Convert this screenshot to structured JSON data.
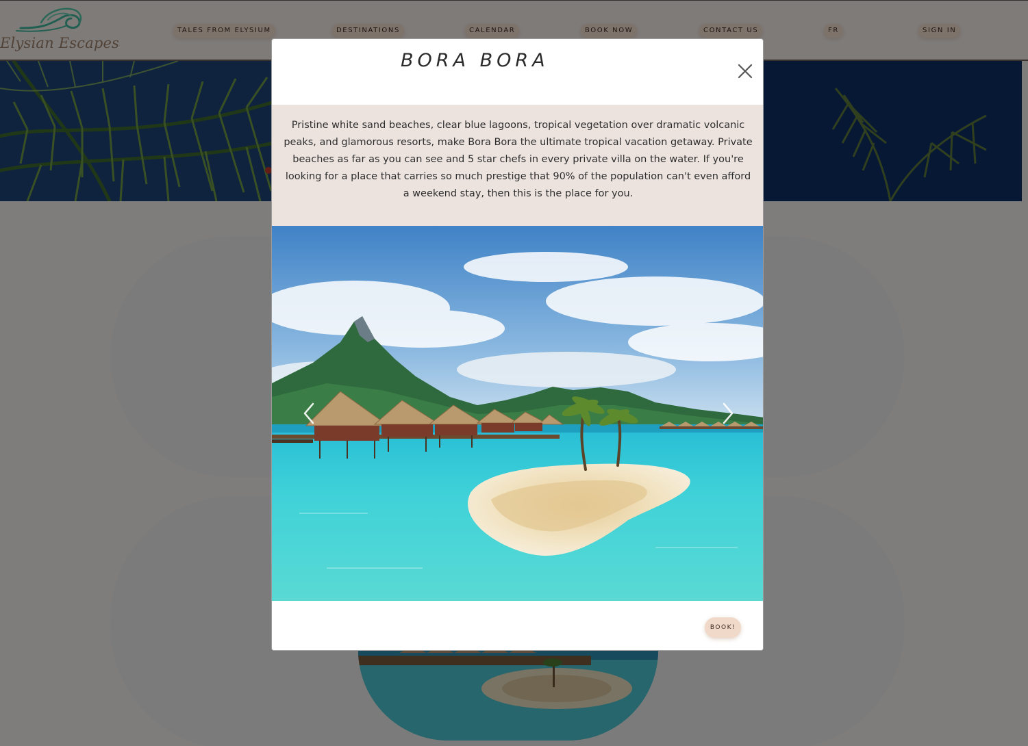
{
  "brand": {
    "name": "Elysian Escapes"
  },
  "nav": {
    "items": [
      {
        "label": "TALES FROM ELYSIUM"
      },
      {
        "label": "DESTINATIONS"
      },
      {
        "label": "CALENDAR"
      },
      {
        "label": "BOOK NOW"
      },
      {
        "label": "CONTACT US"
      },
      {
        "label": "FR"
      },
      {
        "label": "SIGN IN"
      }
    ]
  },
  "modal": {
    "title": "BORA BORA",
    "description": "Pristine white sand beaches, clear blue lagoons, tropical vegetation over dramatic volcanic peaks, and glamorous resorts, make Bora Bora the ultimate tropical vacation getaway. Private beaches as far as you can see and 5 star chefs in every private villa on the water. If you're looking for a place that carries so much prestige that 90% of the population can't even afford a weekend stay, then this is the place for you.",
    "book_label": "BOOK!",
    "close_icon": "close-icon",
    "prev_icon": "chevron-left-icon",
    "next_icon": "chevron-right-icon"
  },
  "colors": {
    "accent_button": "#f0d9c8",
    "description_bg": "#ece3df",
    "navbar_bg": "#f3ece8",
    "overlay": "rgba(0,0,0,0.48)"
  }
}
